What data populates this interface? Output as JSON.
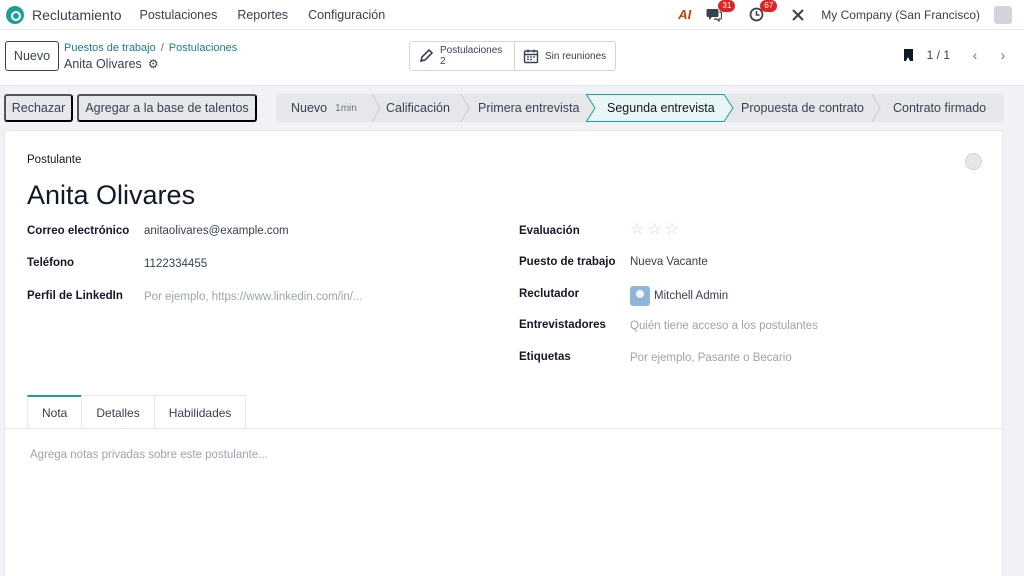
{
  "topnav": {
    "app_name": "Reclutamiento",
    "menu": [
      "Postulaciones",
      "Reportes",
      "Configuración"
    ],
    "ai_label": "AI",
    "messages_count": "31",
    "activities_count": "67",
    "company": "My Company (San Francisco)"
  },
  "control": {
    "new_label": "Nuevo",
    "breadcrumb": [
      "Puestos de trabajo",
      "Postulaciones"
    ],
    "record_title": "Anita Olivares",
    "smart_buttons": [
      {
        "label": "Postulaciones",
        "value": "2"
      },
      {
        "label": "Sin reuniones"
      }
    ],
    "pager": "1 / 1"
  },
  "actions": {
    "reject": "Rechazar",
    "talent_pool": "Agregar a la base de talentos"
  },
  "stages": [
    {
      "label": "Nuevo",
      "duration": "1min"
    },
    {
      "label": "Calificación"
    },
    {
      "label": "Primera entrevista"
    },
    {
      "label": "Segunda entrevista"
    },
    {
      "label": "Propuesta de contrato"
    },
    {
      "label": "Contrato firmado"
    }
  ],
  "active_stage": "Segunda entrevista",
  "form": {
    "section_label": "Postulante",
    "name": "Anita Olivares",
    "left": [
      {
        "label": "Correo electrónico",
        "value": "anitaolivares@example.com"
      },
      {
        "label": "Teléfono",
        "value": "1122334455"
      },
      {
        "label": "Perfil de LinkedIn",
        "placeholder": "Por ejemplo, https://www.linkedin.com/in/..."
      }
    ],
    "right": [
      {
        "label": "Evaluación",
        "stars": 0,
        "max_stars": 3
      },
      {
        "label": "Puesto de trabajo",
        "value": "Nueva Vacante"
      },
      {
        "label": "Reclutador",
        "value": "Mitchell Admin"
      },
      {
        "label": "Entrevistadores",
        "placeholder": "Quién tiene acceso a los postulantes"
      },
      {
        "label": "Etiquetas",
        "placeholder": "Por ejemplo, Pasante o Becario"
      }
    ]
  },
  "tabs": [
    "Nota",
    "Detalles",
    "Habilidades"
  ],
  "active_tab": "Nota",
  "note_placeholder": "Agrega notas privadas sobre este postulante...",
  "colors": {
    "brand": "#1aa097",
    "active_stage_fill": "#e8f6f5",
    "badge": "#dc2626"
  }
}
